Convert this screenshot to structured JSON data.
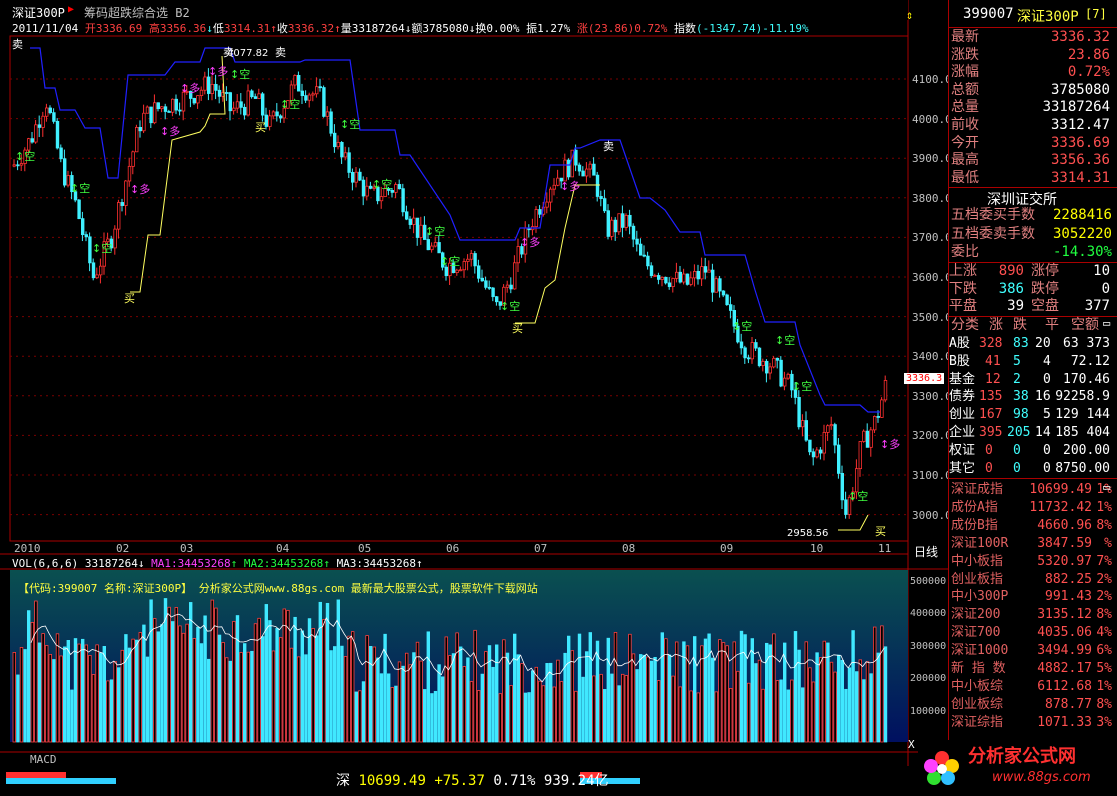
{
  "header": {
    "code": "深证300P",
    "formula": "筹码超跌综合选 B2",
    "info": {
      "date": "2011/11/04",
      "open_label": "开",
      "open": "3336.69",
      "high_label": "高",
      "high": "3356.36",
      "low_label": "低",
      "low": "3314.31",
      "close_label": "收",
      "close": "3336.32",
      "vol_label": "量",
      "vol": "33187264",
      "amt_label": "额",
      "amt": "3785080",
      "turn_label": "换",
      "turn": "0.00%",
      "swing_label": "振",
      "swing": "1.27%",
      "chg_label": "涨",
      "chg": "(23.86)0.72%",
      "index_label": "指数",
      "index": "(-1347.74)-11.19%"
    }
  },
  "y_axis_labels": [
    "4100.0",
    "4000.0",
    "3900.0",
    "3800.0",
    "3700.0",
    "3600.0",
    "3500.0",
    "3400.0",
    "3300.0",
    "3200.0",
    "3100.0",
    "3000.0"
  ],
  "x_axis_labels": [
    "2010",
    "02",
    "03",
    "04",
    "05",
    "06",
    "07",
    "08",
    "09",
    "10",
    "11"
  ],
  "period_label": "日线",
  "current_price_tag": "3336.3",
  "annotations": {
    "max_value": "4077.82",
    "min_value": "2958.56",
    "buy": "买",
    "sell": "卖",
    "long": "多",
    "short": "空"
  },
  "volume": {
    "header": "VOL(6,6,6)",
    "vol": "33187264",
    "ma1_label": "MA1:",
    "ma1": "34453268",
    "ma2_label": "MA2:",
    "ma2": "34453268",
    "ma3_label": "MA3:",
    "ma3": "34453268",
    "note": "【代码:399007 名称:深证300P】  分析家公式网www.88gs.com 最新最大股票公式，股票软件下载网站",
    "axis": [
      "500000",
      "400000",
      "300000",
      "200000",
      "100000"
    ]
  },
  "macd_label": "MACD",
  "ticker": {
    "market": "深",
    "price": "10699.49",
    "change": "+75.37",
    "pct": "0.71%",
    "amount": "939.24亿"
  },
  "right_panel": {
    "title_code": "399007",
    "title_name": "深证300P",
    "title_suffix": "[7]",
    "quotes": [
      {
        "label": "最新",
        "value": "3336.32",
        "color": "#ff5050"
      },
      {
        "label": "涨跌",
        "value": "23.86",
        "color": "#ff5050"
      },
      {
        "label": "涨幅",
        "value": "0.72%",
        "color": "#ff5050"
      },
      {
        "label": "总额",
        "value": "3785080",
        "color": "#ffffff"
      },
      {
        "label": "总量",
        "value": "33187264",
        "color": "#ffffff"
      },
      {
        "label": "前收",
        "value": "3312.47",
        "color": "#ffffff"
      },
      {
        "label": "今开",
        "value": "3336.69",
        "color": "#ff5050"
      },
      {
        "label": "最高",
        "value": "3356.36",
        "color": "#ff5050"
      },
      {
        "label": "最低",
        "value": "3314.31",
        "color": "#ff5050"
      }
    ],
    "exchange": "深圳证交所",
    "order_rows": [
      {
        "label": "五档委买手数",
        "value": "2288416",
        "color": "#ffff00"
      },
      {
        "label": "五档委卖手数",
        "value": "3052220",
        "color": "#ffff00"
      },
      {
        "label": "委比",
        "value": "-14.30%",
        "color": "#20ff40"
      }
    ],
    "updown": [
      {
        "l1": "上涨",
        "v1": "890",
        "l2": "涨停",
        "v2": "10"
      },
      {
        "l1": "下跌",
        "v1": "386",
        "l2": "跌停",
        "v2": "0"
      },
      {
        "l1": "平盘",
        "v1": "39",
        "l2": "空盘",
        "v2": "377"
      }
    ],
    "cat_header": [
      "分类",
      "涨",
      "跌",
      "平",
      "空额"
    ],
    "categories": [
      {
        "name": "A股",
        "up": "328",
        "down": "83",
        "flat": "20",
        "amt": "63 373"
      },
      {
        "name": "B股",
        "up": "41",
        "down": "5",
        "flat": "4",
        "amt": "72.12"
      },
      {
        "name": "基金",
        "up": "12",
        "down": "2",
        "flat": "0",
        "amt": "170.46"
      },
      {
        "name": "债券",
        "up": "135",
        "down": "38",
        "flat": "16",
        "amt": "92258.9"
      },
      {
        "name": "创业",
        "up": "167",
        "down": "98",
        "flat": "5",
        "amt": "129 144"
      },
      {
        "name": "企业",
        "up": "395",
        "down": "205",
        "flat": "14",
        "amt": "185 404"
      },
      {
        "name": "权证",
        "up": "0",
        "down": "0",
        "flat": "0",
        "amt": "200.00"
      },
      {
        "name": "其它",
        "up": "0",
        "down": "0",
        "flat": "0",
        "amt": "8750.00"
      }
    ],
    "indices": [
      {
        "name": "深证成指",
        "value": "10699.49",
        "pct": "1%"
      },
      {
        "name": "成份A指",
        "value": "11732.42",
        "pct": "1%"
      },
      {
        "name": "成份B指",
        "value": "4660.96",
        "pct": "8%"
      },
      {
        "name": "深证100R",
        "value": "3847.59",
        "pct": "%"
      },
      {
        "name": "中小板指",
        "value": "5320.97",
        "pct": "7%"
      },
      {
        "name": "创业板指",
        "value": "882.25",
        "pct": "2%"
      },
      {
        "name": "中小300P",
        "value": "991.43",
        "pct": "2%"
      },
      {
        "name": "深证200",
        "value": "3135.12",
        "pct": "8%"
      },
      {
        "name": "深证700",
        "value": "4035.06",
        "pct": "4%"
      },
      {
        "name": "深证1000",
        "value": "3494.99",
        "pct": "6%"
      },
      {
        "name": "新 指 数",
        "value": "4882.17",
        "pct": "5%"
      },
      {
        "name": "中小板综",
        "value": "6112.68",
        "pct": "1%"
      },
      {
        "name": "创业板综",
        "value": "878.77",
        "pct": "8%"
      },
      {
        "name": "深证综指",
        "value": "1071.33",
        "pct": "3%"
      }
    ]
  },
  "watermark": {
    "title": "分析家公式网",
    "url": "www.88gs.com"
  },
  "colors": {
    "up": "#ff3030",
    "down": "#40f0ff",
    "blue_line": "#2020ff",
    "yellow_line": "#ffff60",
    "panel_border": "#aa0000"
  }
}
